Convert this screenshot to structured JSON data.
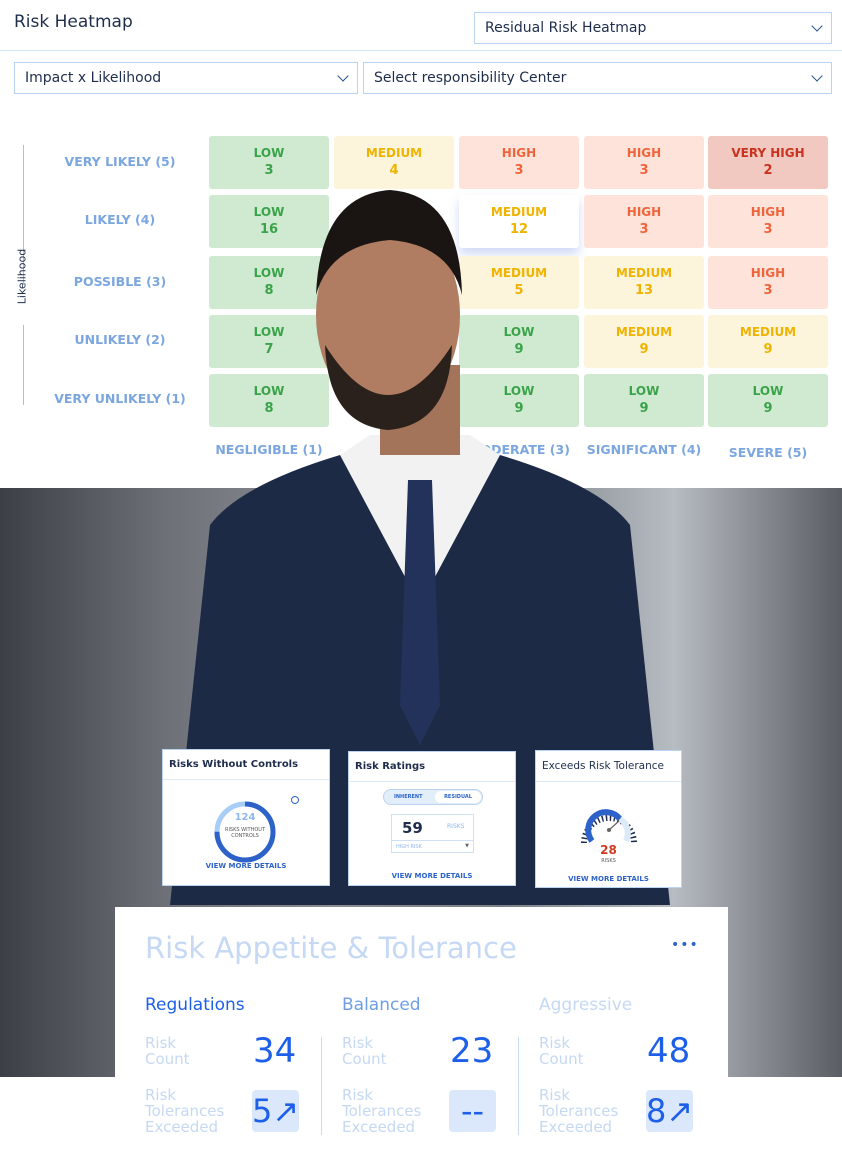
{
  "header": {
    "title": "Risk Heatmap",
    "heatmap_select": "Residual Risk Heatmap",
    "matrix_select": "Impact x Likelihood",
    "center_select": "Select responsibility Center"
  },
  "chart_data": {
    "type": "heatmap",
    "ylabel": "Likelihood",
    "rows": [
      "VERY LIKELY (5)",
      "LIKELY (4)",
      "POSSIBLE (3)",
      "UNLIKELY (2)",
      "VERY UNLIKELY (1)"
    ],
    "columns": [
      "NEGLIGIBLE (1)",
      "",
      "MODERATE (3)",
      "SIGNIFICANT (4)",
      "SEVERE (5)"
    ],
    "cells": [
      [
        {
          "level": "LOW",
          "count": "3"
        },
        {
          "level": "MEDIUM",
          "count": "4"
        },
        {
          "level": "HIGH",
          "count": "3"
        },
        {
          "level": "HIGH",
          "count": "3"
        },
        {
          "level": "VERY HIGH",
          "count": "2"
        }
      ],
      [
        {
          "level": "LOW",
          "count": "16"
        },
        null,
        {
          "level": "MEDIUM",
          "count": "12"
        },
        {
          "level": "HIGH",
          "count": "3"
        },
        {
          "level": "HIGH",
          "count": "3"
        }
      ],
      [
        {
          "level": "LOW",
          "count": "8"
        },
        null,
        {
          "level": "MEDIUM",
          "count": "5"
        },
        {
          "level": "MEDIUM",
          "count": "13"
        },
        {
          "level": "HIGH",
          "count": "3"
        }
      ],
      [
        {
          "level": "LOW",
          "count": "7"
        },
        null,
        {
          "level": "LOW",
          "count": "9"
        },
        {
          "level": "MEDIUM",
          "count": "9"
        },
        {
          "level": "MEDIUM",
          "count": "9"
        }
      ],
      [
        {
          "level": "LOW",
          "count": "8"
        },
        null,
        {
          "level": "LOW",
          "count": "9"
        },
        {
          "level": "LOW",
          "count": "9"
        },
        {
          "level": "LOW",
          "count": "9"
        }
      ]
    ],
    "colors": {
      "LOW": "#cfead0",
      "MEDIUM": "#fdf4dc",
      "HIGH": "#fde3da",
      "VERY HIGH": "#f2c9c0"
    }
  },
  "cards": {
    "controls": {
      "title": "Risks Without Controls",
      "value": "124",
      "label": "RISKS WITHOUT CONTROLS",
      "link": "VIEW MORE DETAILS",
      "fraction": 0.75
    },
    "ratings": {
      "title": "Risk Ratings",
      "tab_inherent": "INHERENT",
      "tab_residual": "RESIDUAL",
      "value": "59",
      "unit": "RISKS",
      "select": "HIGH RISK",
      "link": "VIEW MORE DETAILS"
    },
    "tolerance": {
      "title": "Exceeds Risk Tolerance",
      "value": "28",
      "unit": "RISKS",
      "link": "VIEW MORE DETAILS"
    }
  },
  "appetite": {
    "title": "Risk Appetite & Tolerance",
    "more": "•••",
    "columns": [
      {
        "name": "Regulations",
        "count_label": "Risk Count",
        "count": "34",
        "exceeded_label": "Risk Tolerances Exceeded",
        "exceeded": "5↗"
      },
      {
        "name": "Balanced",
        "count_label": "Risk Count",
        "count": "23",
        "exceeded_label": "Risk Tolerances Exceeded",
        "exceeded": "--"
      },
      {
        "name": "Aggressive",
        "count_label": "Risk Count",
        "count": "48",
        "exceeded_label": "Risk Tolerances Exceeded",
        "exceeded": "8↗"
      }
    ]
  }
}
